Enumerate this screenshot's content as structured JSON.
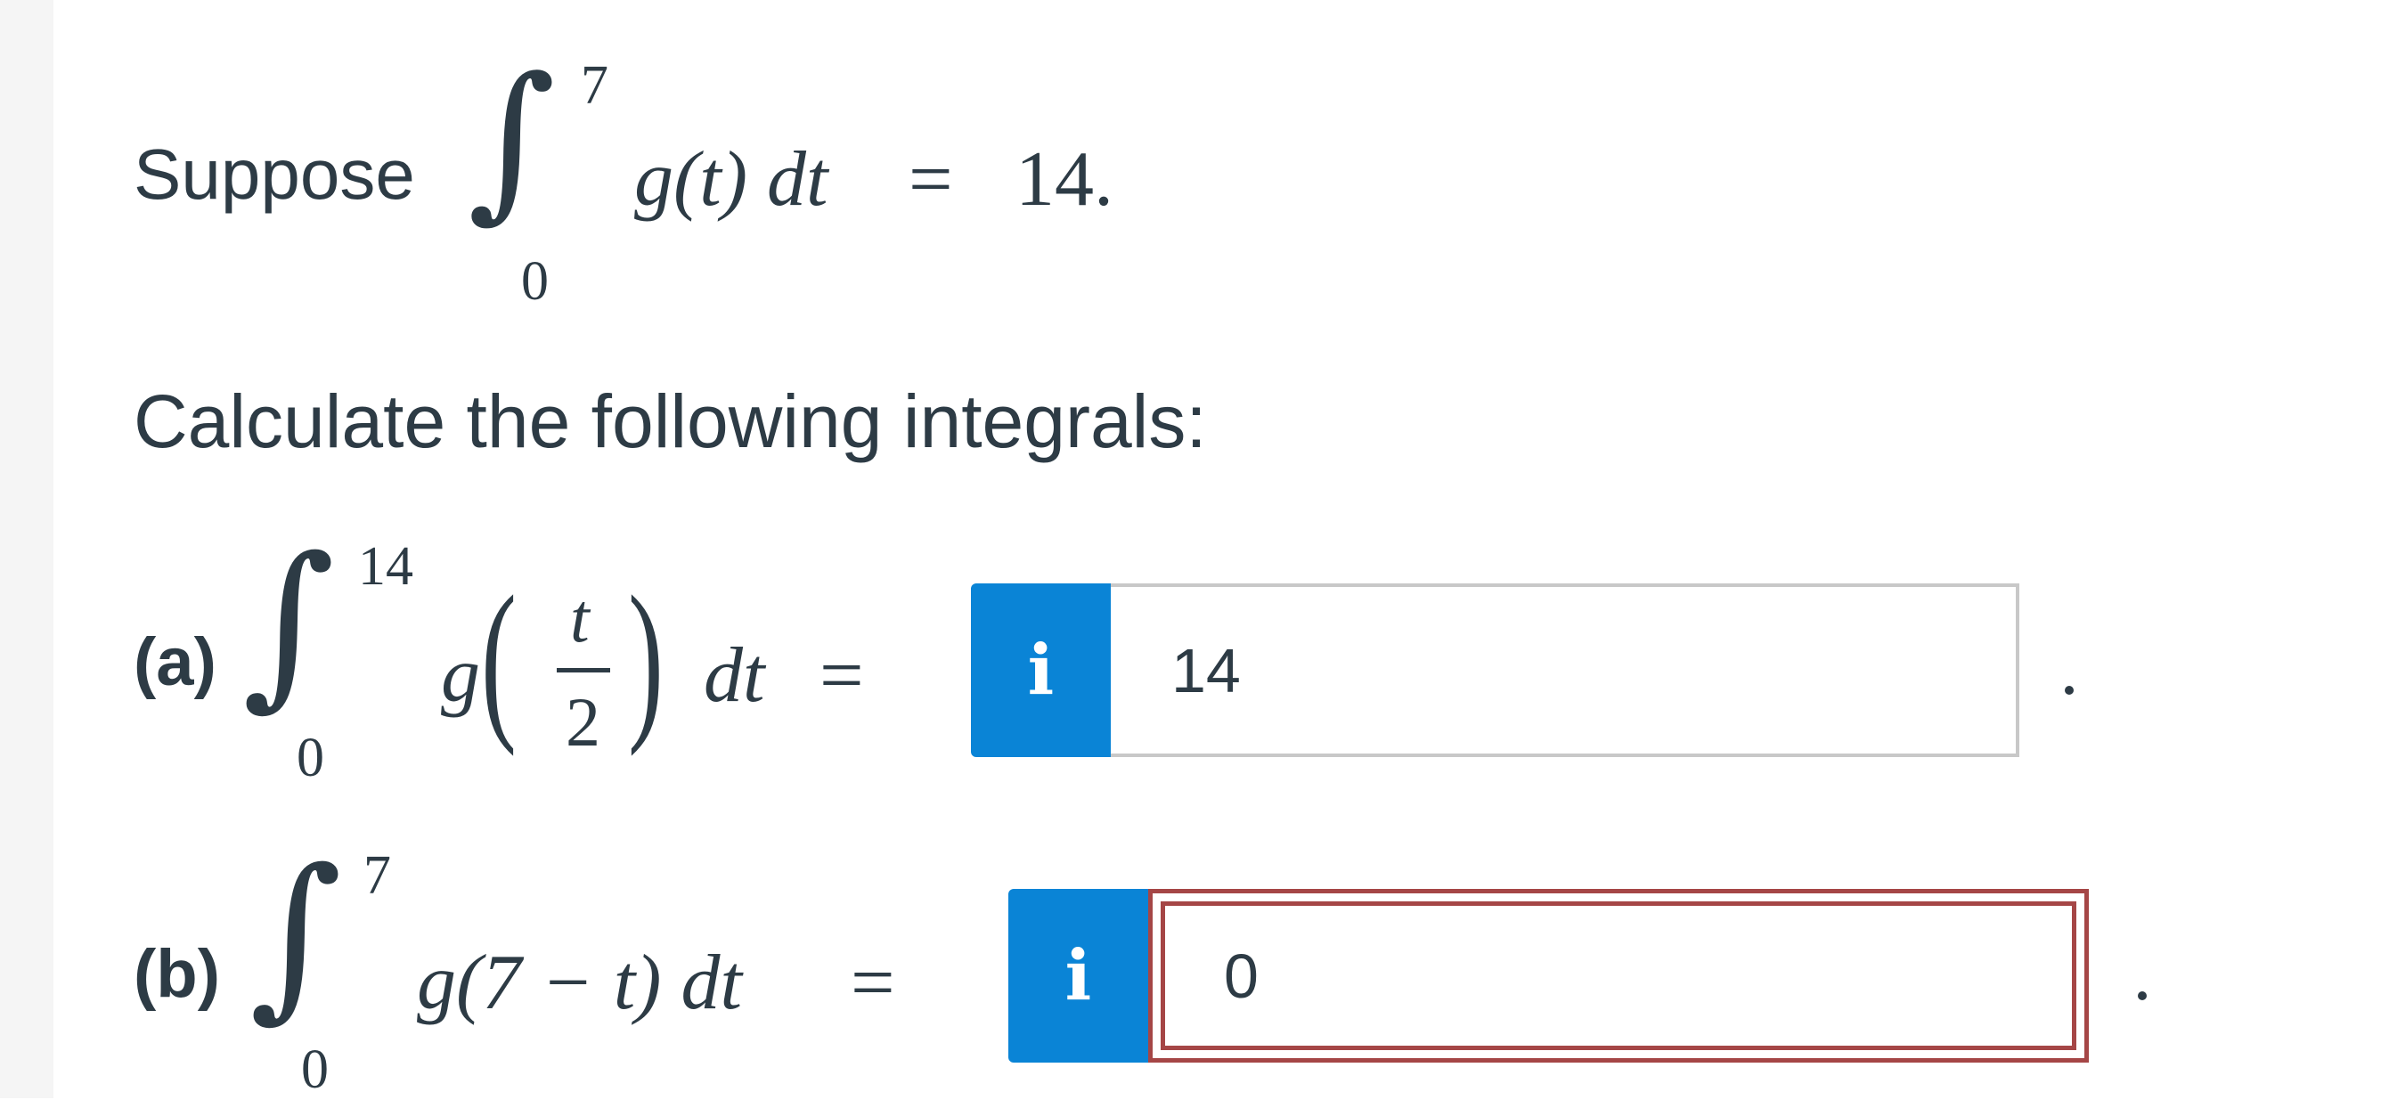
{
  "intro": {
    "lead_text": "Suppose",
    "integral_upper": "7",
    "integral_lower": "0",
    "integrand": "g(t) dt",
    "equals": "=",
    "value": "14."
  },
  "instruction": "Calculate the following integrals:",
  "parts": [
    {
      "label": "(a)",
      "upper": "14",
      "lower": "0",
      "integrand_func": "g",
      "frac_num": "t",
      "frac_den": "2",
      "tail": "dt",
      "equals": "=",
      "info_icon": "i",
      "answer": "14",
      "status": "neutral",
      "end_punct": "."
    },
    {
      "label": "(b)",
      "upper": "7",
      "lower": "0",
      "integrand": "g(7 − t) dt",
      "equals": "=",
      "info_icon": "i",
      "answer": "0",
      "status": "incorrect",
      "end_punct": "."
    }
  ],
  "colors": {
    "text": "#2d3b45",
    "info_button": "#0a84d6",
    "incorrect_border": "#a54646",
    "neutral_border": "#c8c8c8"
  }
}
